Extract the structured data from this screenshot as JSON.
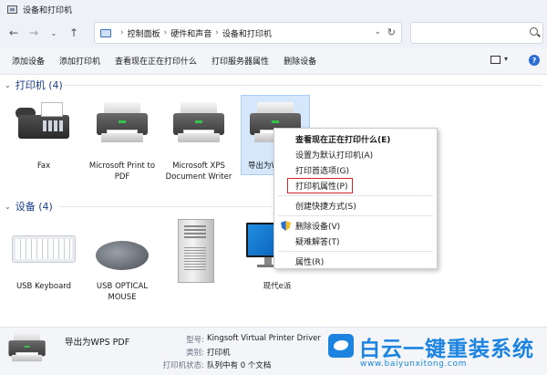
{
  "window": {
    "title": "设备和打印机"
  },
  "nav": {
    "breadcrumb": [
      "控制面板",
      "硬件和声音",
      "设备和打印机"
    ]
  },
  "toolbar": {
    "items": [
      "添加设备",
      "添加打印机",
      "查看现在正在打印什么",
      "打印服务器属性",
      "删除设备"
    ]
  },
  "sections": {
    "printers": {
      "label": "打印机 (4)"
    },
    "devices": {
      "label": "设备 (4)"
    }
  },
  "printers": [
    {
      "name": "Fax",
      "icon": "fax-icon"
    },
    {
      "name": "Microsoft Print to PDF",
      "icon": "printer-icon"
    },
    {
      "name": "Microsoft XPS Document Writer",
      "icon": "printer-icon"
    },
    {
      "name": "导出为W",
      "icon": "printer-icon",
      "selected": true
    }
  ],
  "devices": [
    {
      "name": "USB Keyboard",
      "icon": "keyboard-icon"
    },
    {
      "name": "USB OPTICAL MOUSE",
      "icon": "mouse-icon"
    },
    {
      "name": "",
      "icon": "computer-tower-icon"
    },
    {
      "name": "现代e派",
      "icon": "monitor-icon"
    }
  ],
  "context_menu": {
    "items": [
      {
        "label": "查看现在正在打印什么(E)",
        "bold": true
      },
      {
        "label": "设置为默认打印机(A)"
      },
      {
        "label": "打印首选项(G)"
      },
      {
        "label": "打印机属性(P)",
        "highlighted": true
      },
      {
        "separator": true
      },
      {
        "label": "创建快捷方式(S)"
      },
      {
        "separator": true
      },
      {
        "label": "删除设备(V)",
        "icon": "shield-icon"
      },
      {
        "label": "疑难解答(T)"
      },
      {
        "separator": true
      },
      {
        "label": "属性(R)"
      }
    ]
  },
  "status_pane": {
    "name": "导出为WPS PDF",
    "fields": [
      {
        "key": "型号:",
        "value": "Kingsoft Virtual Printer Driver"
      },
      {
        "key": "类别:",
        "value": "打印机"
      },
      {
        "key": "打印机状态:",
        "value": "队列中有 0 个文档"
      }
    ]
  },
  "watermark": {
    "text": "白云一键重装系统",
    "url": "www.baiyunxitong.com"
  },
  "colors": {
    "section_header": "#1a3c8a",
    "selection": "#d5e7fb",
    "highlight_box": "#d6262a",
    "watermark": "#1c84e0"
  }
}
